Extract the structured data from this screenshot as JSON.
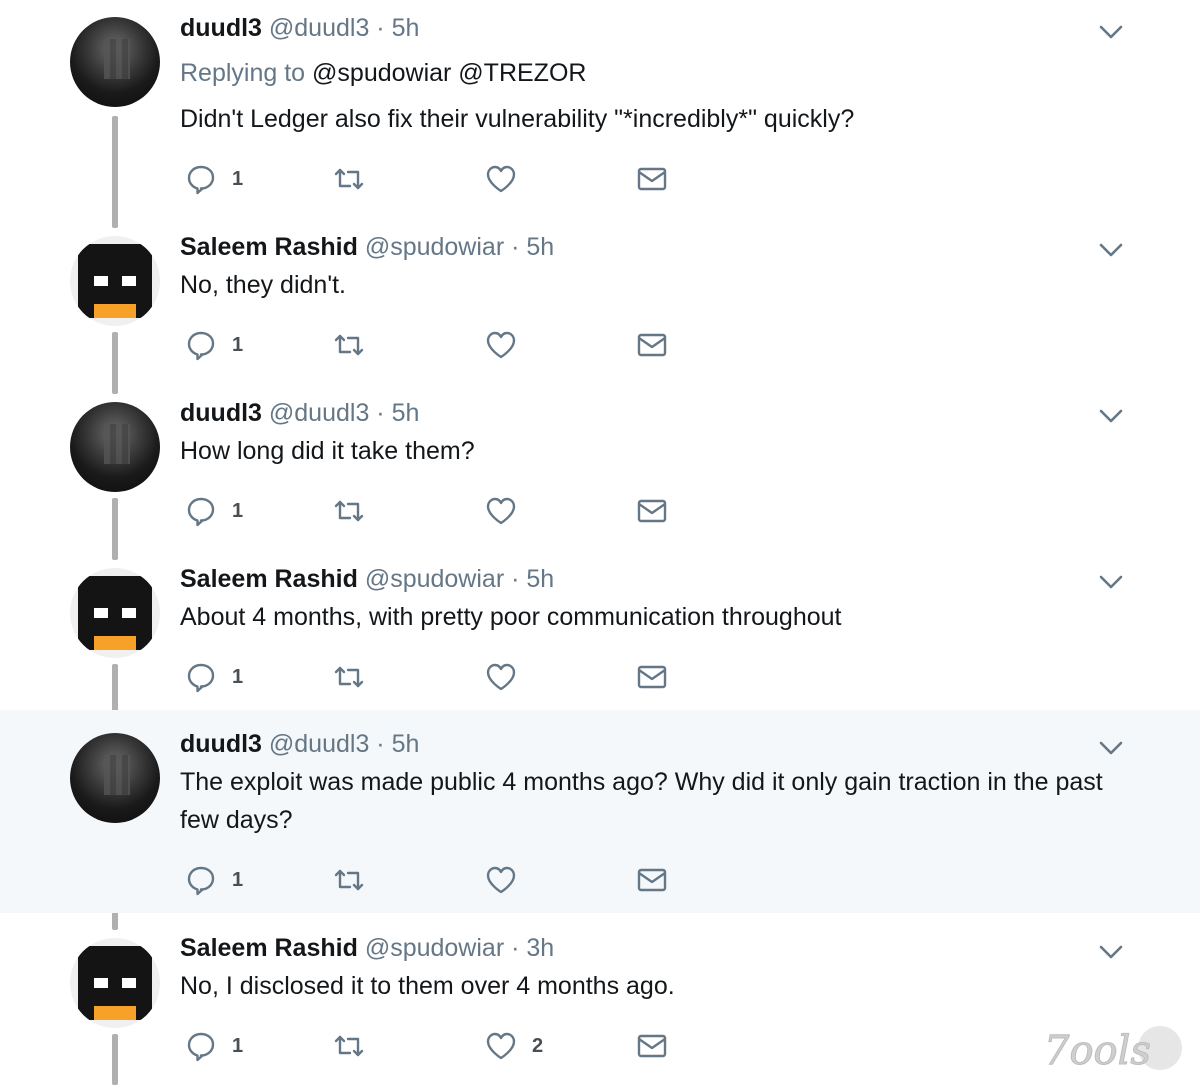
{
  "colors": {
    "highlight_bg": "#f5f8fa",
    "name": "#14171a",
    "meta": "#657786",
    "icon": "#657786"
  },
  "tweets": [
    {
      "name": "duudl3",
      "handle": "@duudl3",
      "time": "· 5h",
      "avatar": "photo",
      "replying_label": "Replying to",
      "replying_to": "@spudowiar @TREZOR",
      "text": "Didn't Ledger also fix their vulnerability \"*incredibly*\" quickly?",
      "reply_count": "1",
      "like_count": "",
      "icons": [
        "reply-icon",
        "retweet-icon",
        "like-icon",
        "dm-icon",
        "chevron-down-icon"
      ]
    },
    {
      "name": "Saleem Rashid",
      "handle": "@spudowiar",
      "time": "· 5h",
      "avatar": "pixel",
      "text": "No, they didn't.",
      "reply_count": "1",
      "like_count": ""
    },
    {
      "name": "duudl3",
      "handle": "@duudl3",
      "time": "· 5h",
      "avatar": "photo",
      "text": "How long did it take them?",
      "reply_count": "1",
      "like_count": ""
    },
    {
      "name": "Saleem Rashid",
      "handle": "@spudowiar",
      "time": "· 5h",
      "avatar": "pixel",
      "text": "About 4 months, with pretty poor communication throughout",
      "reply_count": "1",
      "like_count": ""
    },
    {
      "name": "duudl3",
      "handle": "@duudl3",
      "time": "· 5h",
      "avatar": "photo",
      "text": "The exploit was made public 4 months ago? Why did it only gain traction in the past few days?",
      "reply_count": "1",
      "like_count": ""
    },
    {
      "name": "Saleem Rashid",
      "handle": "@spudowiar",
      "time": "· 3h",
      "avatar": "pixel",
      "text": "No, I disclosed it to them over 4 months ago.",
      "reply_count": "1",
      "like_count": "2"
    }
  ],
  "watermark": "7ools"
}
